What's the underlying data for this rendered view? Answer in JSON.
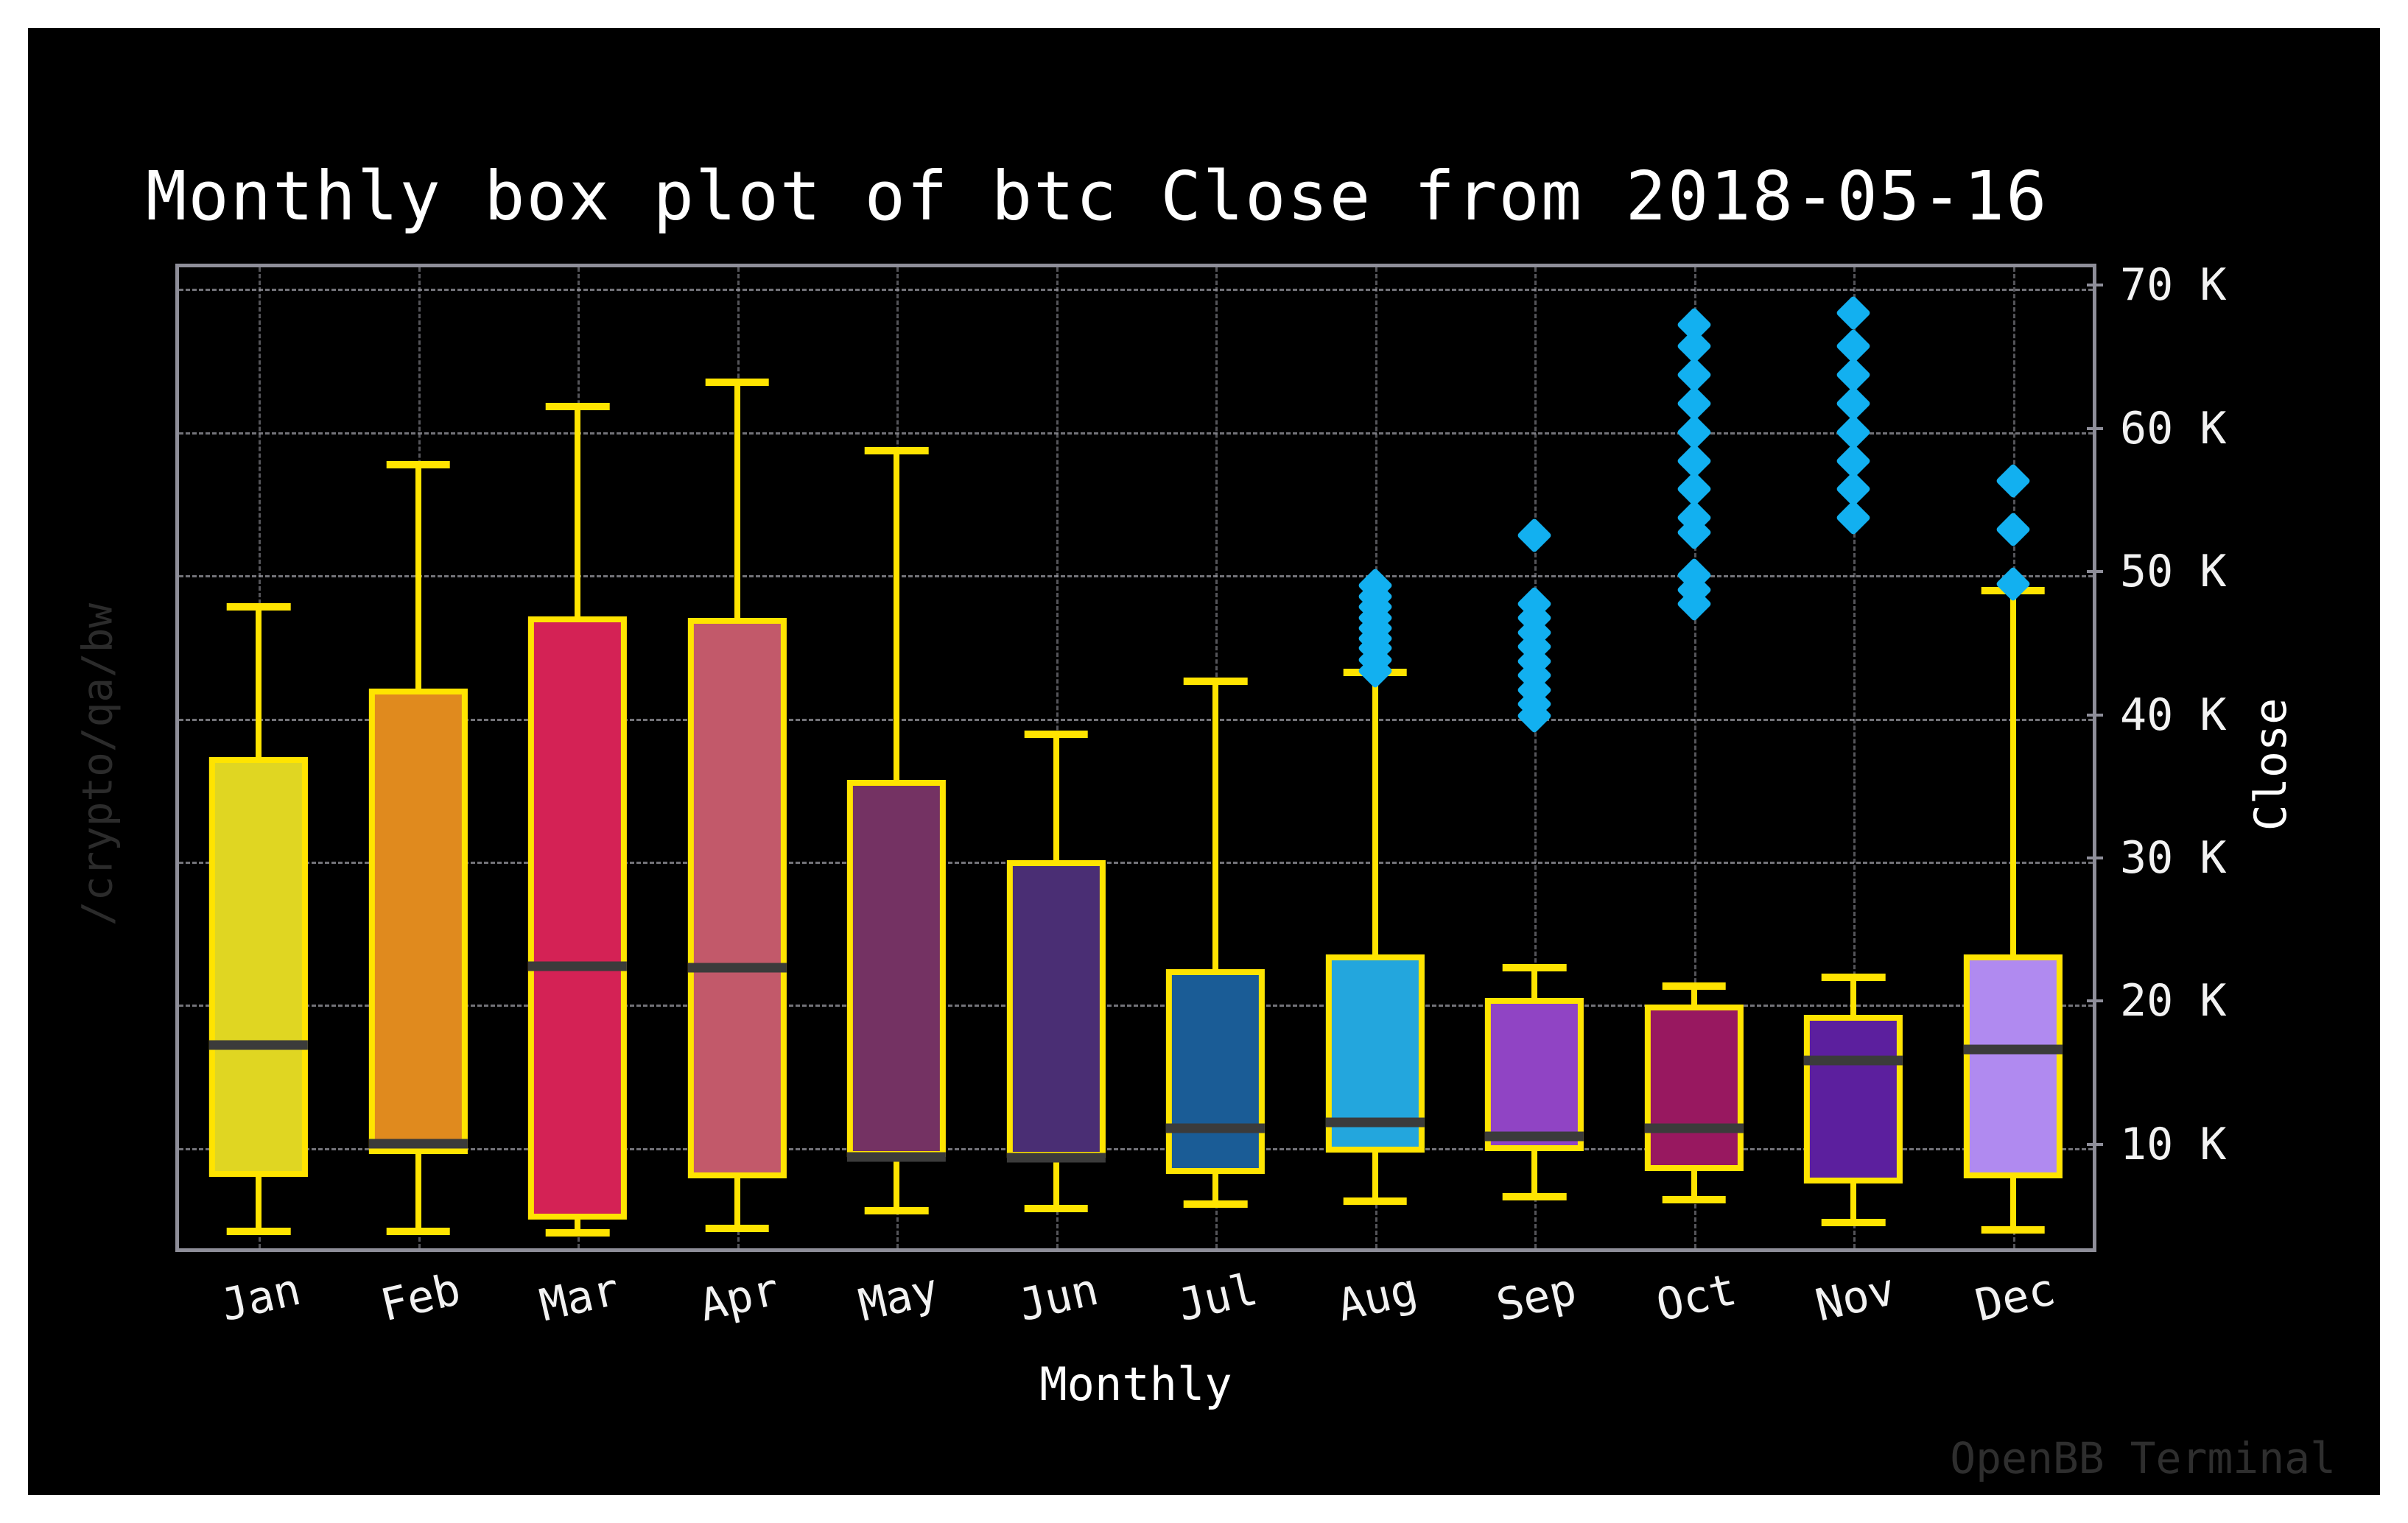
{
  "title": "Monthly box plot of btc Close from 2018-05-16",
  "xlabel": "Monthly",
  "ylabel": "Close",
  "watermark_left": "/crypto/qa/bw",
  "watermark_brand": "OpenBB Terminal",
  "colors": {
    "background": "#000000",
    "page": "#ffffff",
    "whisker": "#ffe400",
    "box_edge": "#ffe400",
    "median": "#3b3b3b",
    "flier": "#12b0f0",
    "grid": "#9a9aa2",
    "axis": "#8e8e99",
    "text": "#f2f2f2",
    "watermark": "#2b2b2b"
  },
  "chart_data": {
    "type": "box",
    "title": "Monthly box plot of btc Close from 2018-05-16",
    "xlabel": "Monthly",
    "ylabel": "Close",
    "ylim": [
      3000,
      71500
    ],
    "grid": true,
    "legend": false,
    "ytick_values": [
      10000,
      20000,
      30000,
      40000,
      50000,
      60000,
      70000
    ],
    "ytick_labels": [
      "10 K",
      "20 K",
      "30 K",
      "40 K",
      "50 K",
      "60 K",
      "70 K"
    ],
    "categories": [
      "Jan",
      "Feb",
      "Mar",
      "Apr",
      "May",
      "Jun",
      "Jul",
      "Aug",
      "Sep",
      "Oct",
      "Nov",
      "Dec"
    ],
    "boxes": [
      {
        "label": "Jan",
        "color": "#e0d622",
        "whisker_low": 4200,
        "q1": 8000,
        "median": 17200,
        "q3": 37300,
        "whisker_high": 47800,
        "fliers": []
      },
      {
        "label": "Feb",
        "color": "#e08a1e",
        "whisker_low": 4200,
        "q1": 9600,
        "median": 10300,
        "q3": 42100,
        "whisker_high": 57700,
        "fliers": []
      },
      {
        "label": "Mar",
        "color": "#d42255",
        "whisker_low": 4100,
        "q1": 5000,
        "median": 22700,
        "q3": 47100,
        "whisker_high": 61800,
        "fliers": []
      },
      {
        "label": "Apr",
        "color": "#c2596a",
        "whisker_low": 4400,
        "q1": 7900,
        "median": 22600,
        "q3": 47000,
        "whisker_high": 63500,
        "fliers": []
      },
      {
        "label": "May",
        "color": "#743263",
        "whisker_low": 5600,
        "q1": 9400,
        "median": 9400,
        "q3": 35700,
        "whisker_high": 58700,
        "fliers": []
      },
      {
        "label": "Jun",
        "color": "#4a2e74",
        "whisker_low": 5800,
        "q1": 9300,
        "median": 9300,
        "q3": 30100,
        "whisker_high": 38900,
        "fliers": []
      },
      {
        "label": "Jul",
        "color": "#1a5c96",
        "whisker_low": 6100,
        "q1": 8200,
        "median": 11400,
        "q3": 22500,
        "whisker_high": 42600,
        "fliers": []
      },
      {
        "label": "Aug",
        "color": "#23a6dd",
        "whisker_low": 6300,
        "q1": 9700,
        "median": 11800,
        "q3": 23500,
        "whisker_high": 43200,
        "fliers": [
          43300,
          44100,
          44900,
          45600,
          46300,
          47000,
          47800,
          48500,
          49300
        ]
      },
      {
        "label": "Sep",
        "color": "#9044c4",
        "whisker_low": 6600,
        "q1": 9800,
        "median": 10800,
        "q3": 20500,
        "whisker_high": 22600,
        "fliers": [
          40200,
          41000,
          42000,
          43000,
          44000,
          45000,
          46000,
          47000,
          48000,
          52800
        ]
      },
      {
        "label": "Oct",
        "color": "#981860",
        "whisker_low": 6400,
        "q1": 8400,
        "median": 11400,
        "q3": 20000,
        "whisker_high": 21300,
        "fliers": [
          48000,
          49000,
          50000,
          53000,
          54000,
          56000,
          58000,
          60000,
          62000,
          64000,
          66000,
          67500
        ]
      },
      {
        "label": "Nov",
        "color": "#5c1f9e",
        "whisker_low": 4800,
        "q1": 7500,
        "median": 16100,
        "q3": 19300,
        "whisker_high": 21900,
        "fliers": [
          54000,
          56000,
          58000,
          60000,
          62000,
          64000,
          66000,
          68300
        ]
      },
      {
        "label": "Dec",
        "color": "#b08af0",
        "whisker_low": 4300,
        "q1": 7900,
        "median": 16900,
        "q3": 23500,
        "whisker_high": 48900,
        "fliers": [
          49400,
          53200,
          56600
        ]
      }
    ]
  }
}
